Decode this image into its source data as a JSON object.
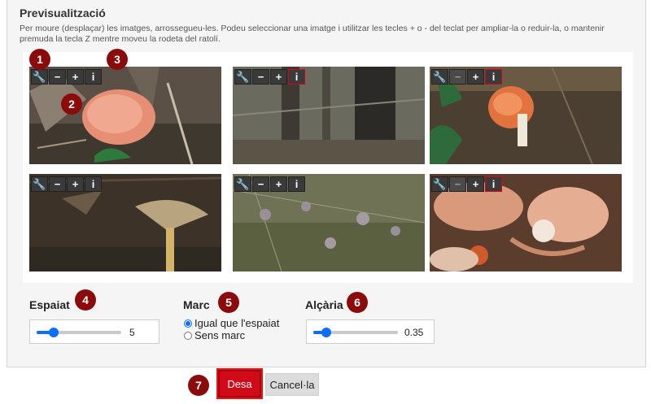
{
  "preview": {
    "title": "Previsualització",
    "help_text": "Per moure (desplaçar) les imatges, arrossegueu-les. Podeu seleccionar una imatge i utilitzar les tecles + o - del teclat per ampliar-la o reduir-la, o mantenir premuda la tecla Z mentre moveu la rodeta del ratolí."
  },
  "tools": {
    "settings": "🔧",
    "minus": "−",
    "plus": "+",
    "info": "i"
  },
  "tiles": [
    {
      "name": "tile-1"
    },
    {
      "name": "tile-2"
    },
    {
      "name": "tile-3"
    },
    {
      "name": "tile-4"
    },
    {
      "name": "tile-5"
    },
    {
      "name": "tile-6"
    }
  ],
  "badges": {
    "b1": "1",
    "b2": "2",
    "b3": "3",
    "b4": "4",
    "b5": "5",
    "b6": "6",
    "b7": "7"
  },
  "spacing": {
    "label": "Espaiat",
    "value": "5",
    "fraction": 0.2
  },
  "frame": {
    "label": "Marc",
    "options": [
      {
        "label": "Igual que l'espaiat",
        "selected": true
      },
      {
        "label": "Sens marc",
        "selected": false
      }
    ]
  },
  "height": {
    "label": "Alçària",
    "value": "0.35",
    "fraction": 0.15
  },
  "actions": {
    "save": "Desa",
    "cancel": "Cancel·la"
  },
  "colors": {
    "accent": "#0b6efd",
    "badge": "#8b0b0b",
    "save": "#d10a1a"
  }
}
